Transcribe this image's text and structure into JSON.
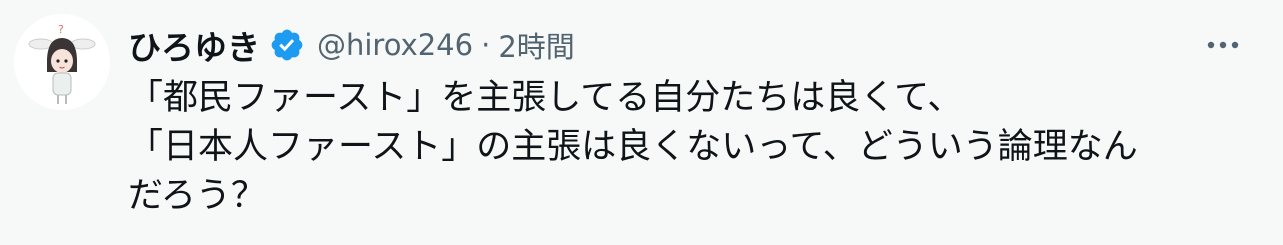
{
  "tweet": {
    "author": {
      "display_name": "ひろゆき",
      "handle": "@hirox246",
      "verified": true,
      "verified_color": "#1d9bf0",
      "avatar_icon": "avatar-illustration"
    },
    "separator": "·",
    "timestamp": "2時間",
    "more_icon": "more-options-icon",
    "text_lines": [
      "「都民ファースト」を主張してる自分たちは良くて、",
      "「日本人ファースト」の主張は良くないって、どういう論理なん",
      "だろう？"
    ]
  },
  "colors": {
    "background": "#f7f9f9",
    "text_primary": "#0f1419",
    "text_secondary": "#536471",
    "accent": "#1d9bf0"
  }
}
